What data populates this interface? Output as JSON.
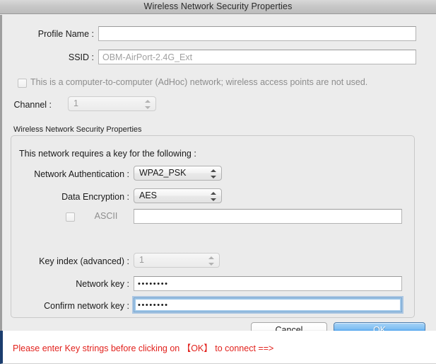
{
  "window": {
    "title": "Wireless Network Security Properties"
  },
  "form": {
    "profile_name_label": "Profile Name :",
    "profile_name_value": "",
    "ssid_label": "SSID :",
    "ssid_value": "OBM-AirPort-2.4G_Ext",
    "adhoc_checkbox_label": "This is a computer-to-computer (AdHoc) network; wireless access points are not used.",
    "channel_label": "Channel :",
    "channel_value": "1"
  },
  "security_group": {
    "title": "Wireless Network Security Properties",
    "intro": "This network requires a key for the following :",
    "network_auth_label": "Network Authentication :",
    "network_auth_value": "WPA2_PSK",
    "data_encryption_label": "Data Encryption :",
    "data_encryption_value": "AES",
    "ascii_label": "ASCII",
    "ascii_value": "",
    "key_index_label": "Key index (advanced) :",
    "key_index_value": "1",
    "network_key_label": "Network key :",
    "network_key_value": "••••••••",
    "confirm_key_label": "Confirm network key :",
    "confirm_key_value": "••••••••"
  },
  "buttons": {
    "cancel": "Cancel",
    "ok": "OK"
  },
  "status": {
    "message": "Please enter Key strings before clicking on 【OK】 to connect ==>",
    "color": "#e2211c"
  }
}
